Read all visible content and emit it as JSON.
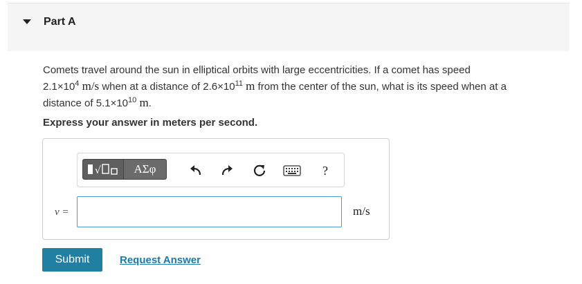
{
  "part": {
    "title": "Part A"
  },
  "question": {
    "line1": "Comets travel around the sun in elliptical orbits with large eccentricities. If a comet has speed",
    "speed_mantissa": "2.1×10",
    "speed_exp": "4",
    "speed_unit": "m/s",
    "mid1": " when at a distance of ",
    "dist1_mantissa": "2.6×10",
    "dist1_exp": "11",
    "dist1_unit": "m",
    "mid2": " from the center of the sun, what is its speed when at a",
    "line3_start": "distance of ",
    "dist2_mantissa": "5.1×10",
    "dist2_exp": "10",
    "dist2_unit": "m",
    "end": "."
  },
  "instruction": "Express your answer in meters per second.",
  "toolbar": {
    "templates_icon": "templates-icon",
    "greek_label": "ΑΣφ",
    "undo_icon": "undo-icon",
    "redo_icon": "redo-icon",
    "reset_icon": "reset-icon",
    "keyboard_icon": "keyboard-icon",
    "help_label": "?"
  },
  "answer": {
    "variable_label": "v =",
    "value": "",
    "unit": "m/s"
  },
  "actions": {
    "submit_label": "Submit",
    "request_label": "Request Answer"
  },
  "colors": {
    "submit_bg": "#217fa1",
    "link": "#1b7aa6",
    "input_border": "#4a9acb"
  }
}
